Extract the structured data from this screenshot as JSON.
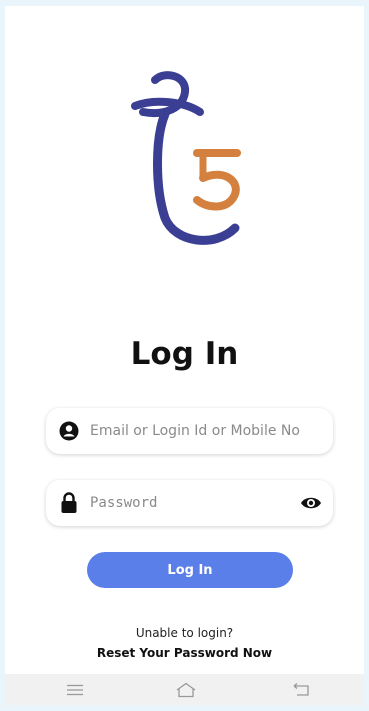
{
  "brand": {
    "logo_icon": "brand-logo-icon",
    "colors": {
      "navy": "#3b3f93",
      "orange": "#d4803f"
    }
  },
  "title": "Log In",
  "email_field": {
    "placeholder": "Email or Login Id or Mobile No",
    "icon": "user-circle-icon"
  },
  "password_field": {
    "placeholder": "Password",
    "icon": "lock-icon",
    "toggle_icon": "eye-icon"
  },
  "login_button": {
    "label": "Log In",
    "color": "#5b7fe8"
  },
  "help": {
    "text": "Unable to login?",
    "link": "Reset Your Password Now"
  },
  "nav_bar": {
    "icons": [
      "menu-icon",
      "home-icon",
      "back-icon"
    ]
  }
}
